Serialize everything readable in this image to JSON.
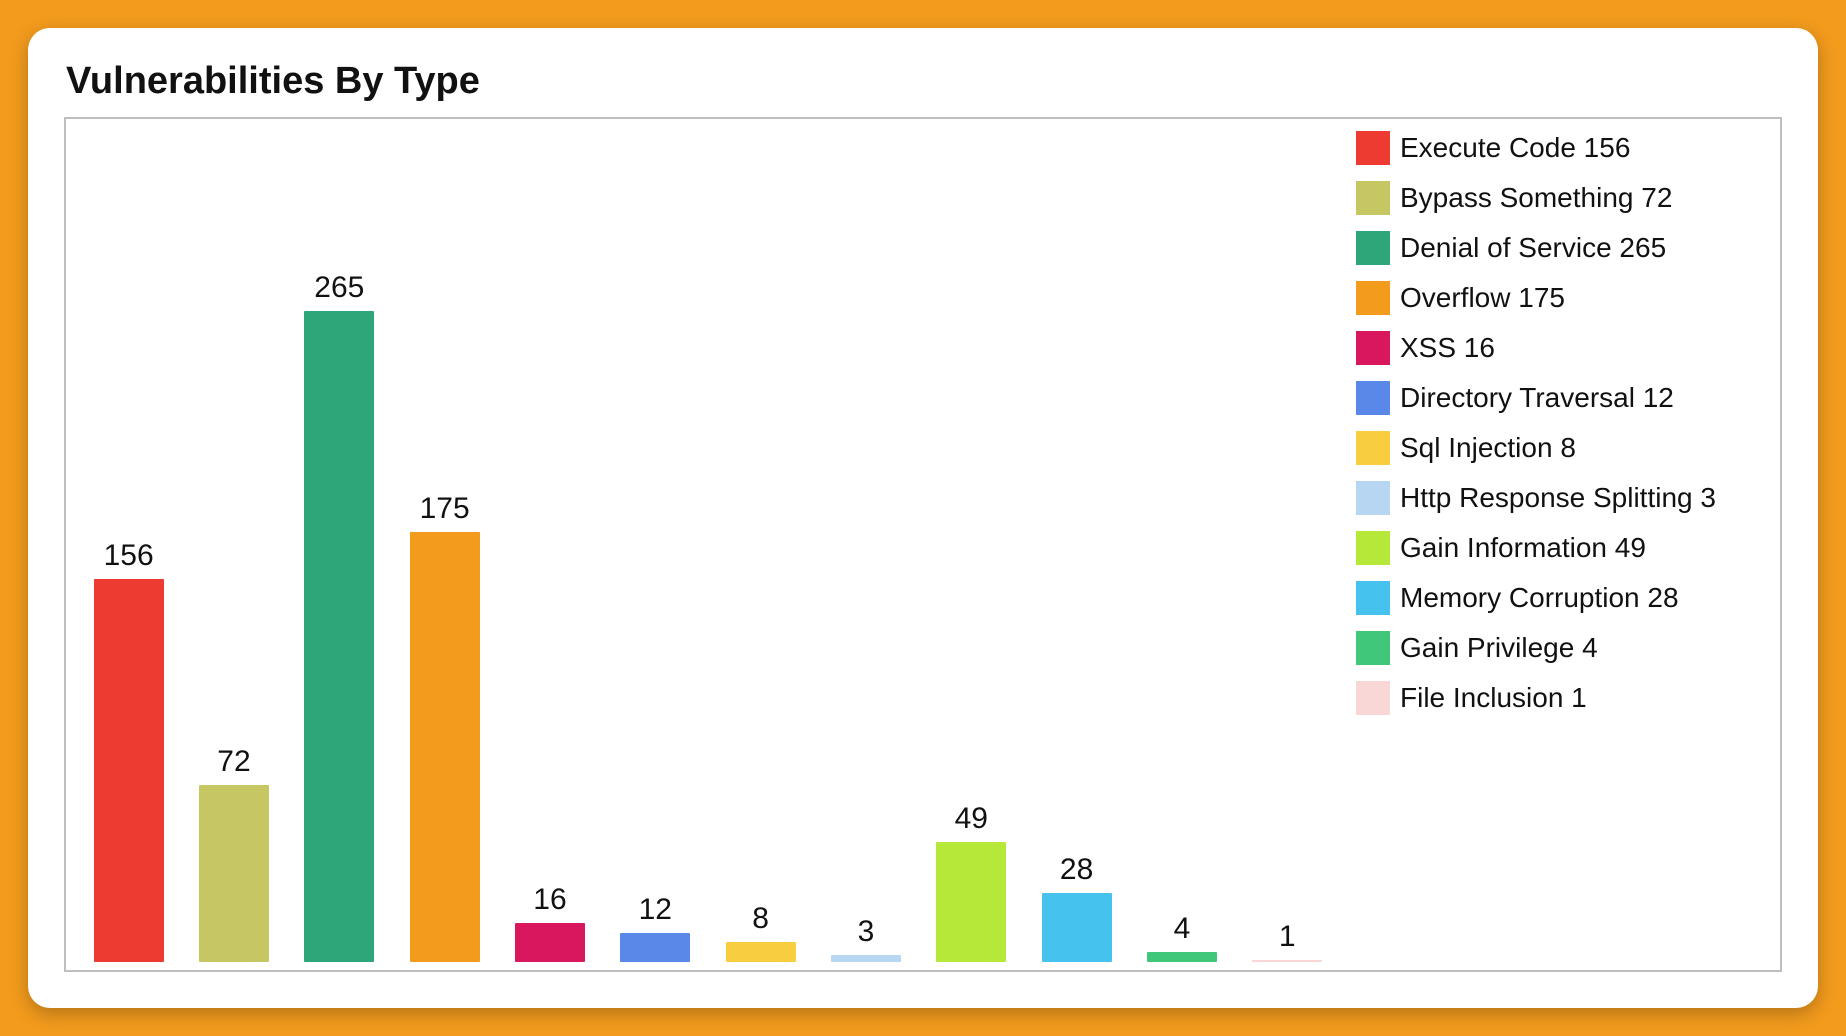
{
  "title": "Vulnerabilities By Type",
  "chart_data": {
    "type": "bar",
    "ylim": [
      0,
      265
    ],
    "categories": [
      "Execute Code",
      "Bypass Something",
      "Denial of Service",
      "Overflow",
      "XSS",
      "Directory Traversal",
      "Sql Injection",
      "Http Response Splitting",
      "Gain Information",
      "Memory Corruption",
      "Gain Privilege",
      "File Inclusion"
    ],
    "values": [
      156,
      72,
      265,
      175,
      16,
      12,
      8,
      3,
      49,
      28,
      4,
      1
    ],
    "colors": [
      "#EE3B32",
      "#C6C663",
      "#2FA57A",
      "#F29B1D",
      "#D9175F",
      "#5A88E8",
      "#F8CD40",
      "#B6D6F1",
      "#B6E83A",
      "#46C2EE",
      "#41C77A",
      "#F9D7D7"
    ]
  }
}
